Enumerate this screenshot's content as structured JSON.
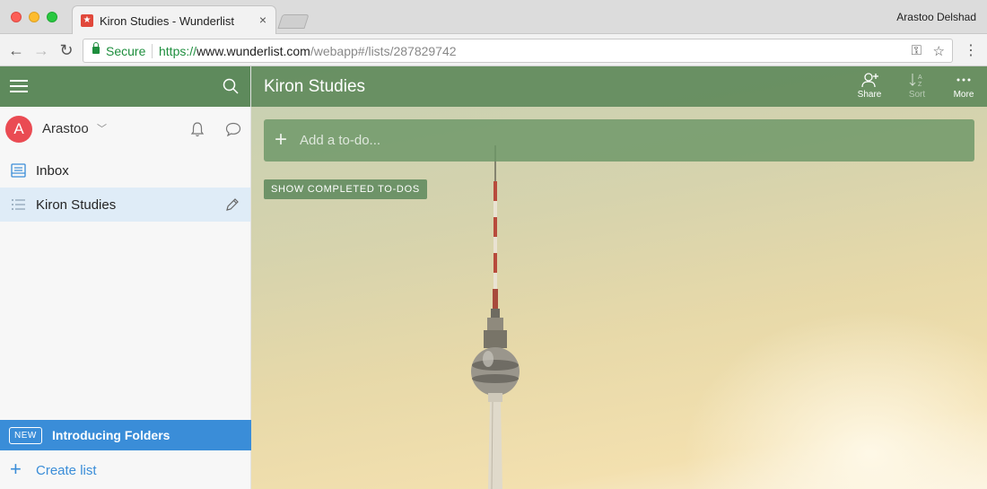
{
  "browser": {
    "tab_title": "Kiron Studies - Wunderlist",
    "tab_close": "×",
    "profile_name": "Arastoo Delshad",
    "secure_label": "Secure",
    "url_scheme": "https://",
    "url_host": "www.wunderlist.com",
    "url_path": "/webapp#/lists/287829742"
  },
  "sidebar": {
    "user": {
      "initial": "A",
      "name": "Arastoo",
      "avatar_color": "#ea4b53"
    },
    "items": [
      {
        "label": "Inbox",
        "icon": "inbox-icon"
      },
      {
        "label": "Kiron Studies",
        "icon": "list-icon",
        "active": true
      }
    ],
    "banner_badge": "NEW",
    "banner_text": "Introducing Folders",
    "create_list": "Create list"
  },
  "main": {
    "title": "Kiron Studies",
    "tools": {
      "share": "Share",
      "sort": "Sort",
      "more": "More"
    },
    "add_placeholder": "Add a to-do...",
    "show_completed": "SHOW COMPLETED TO-DOS"
  },
  "colors": {
    "toolbar_green": "#5e8a5c",
    "accent_blue": "#3a8dd8",
    "secure_green": "#1e8e3e"
  }
}
